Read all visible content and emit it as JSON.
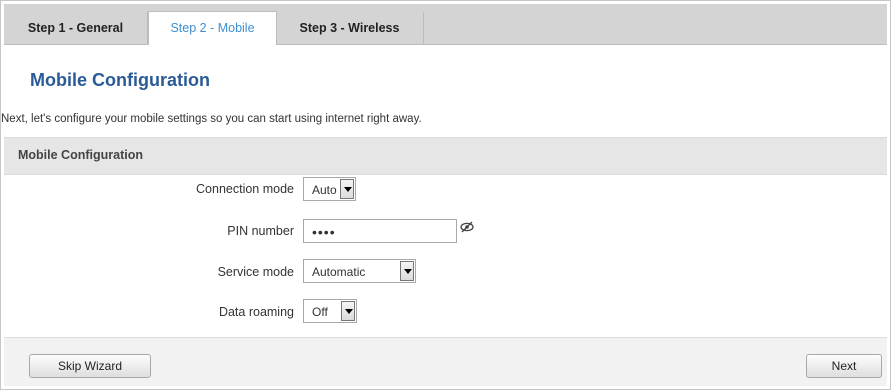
{
  "tabs": [
    {
      "label": "Step 1 - General",
      "active": false
    },
    {
      "label": "Step 2 - Mobile",
      "active": true
    },
    {
      "label": "Step 3 - Wireless",
      "active": false
    }
  ],
  "page_title": "Mobile Configuration",
  "intro_text": "Next, let's configure your mobile settings so you can start using internet right away.",
  "section_title": "Mobile Configuration",
  "fields": {
    "connection_mode": {
      "label": "Connection mode",
      "value": "Auto"
    },
    "pin_number": {
      "label": "PIN number",
      "value": "••••"
    },
    "service_mode": {
      "label": "Service mode",
      "value": "Automatic"
    },
    "data_roaming": {
      "label": "Data roaming",
      "value": "Off"
    }
  },
  "buttons": {
    "skip": "Skip Wizard",
    "next": "Next"
  },
  "colors": {
    "title": "#2b5b97",
    "active_tab": "#3f8fd0",
    "tabbar": "#d4d4d4",
    "section": "#e6e6e6"
  },
  "icons": {
    "pin_toggle": "eye-slash-icon",
    "dropdown": "triangle-down-icon"
  }
}
